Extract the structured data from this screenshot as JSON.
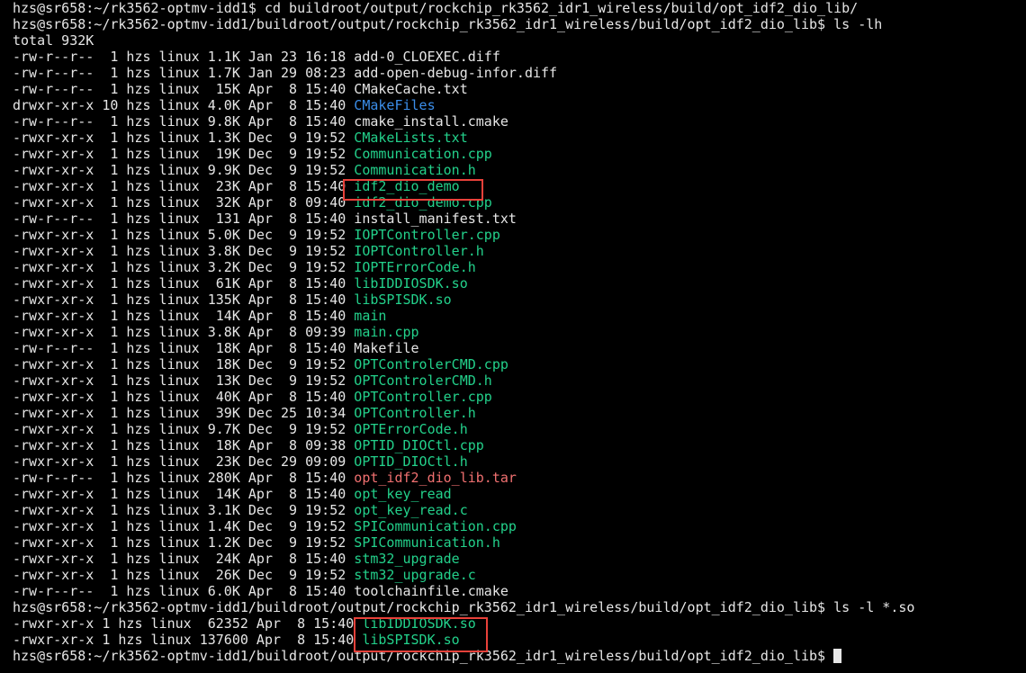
{
  "cut_line": "hzs@sr658:~/rk3562-optmv-idd1$ cd buildroot/output/rockchip_rk3562_idr1_wireless/build/opt_idf2_dio_lib/",
  "prompt1": "hzs@sr658:~/rk3562-optmv-idd1/buildroot/output/rockchip_rk3562_idr1_wireless/build/opt_idf2_dio_lib$ ls -lh",
  "total": "total 932K",
  "listing": [
    {
      "meta": "-rw-r--r--  1 hzs linux 1.1K Jan 23 16:18 ",
      "name": "add-0_CLOEXEC.diff",
      "color": "white"
    },
    {
      "meta": "-rw-r--r--  1 hzs linux 1.7K Jan 29 08:23 ",
      "name": "add-open-debug-infor.diff",
      "color": "white"
    },
    {
      "meta": "-rw-r--r--  1 hzs linux  15K Apr  8 15:40 ",
      "name": "CMakeCache.txt",
      "color": "white"
    },
    {
      "meta": "drwxr-xr-x 10 hzs linux 4.0K Apr  8 15:40 ",
      "name": "CMakeFiles",
      "color": "blue"
    },
    {
      "meta": "-rw-r--r--  1 hzs linux 9.8K Apr  8 15:40 ",
      "name": "cmake_install.cmake",
      "color": "white"
    },
    {
      "meta": "-rwxr-xr-x  1 hzs linux 1.3K Dec  9 19:52 ",
      "name": "CMakeLists.txt",
      "color": "green"
    },
    {
      "meta": "-rwxr-xr-x  1 hzs linux  19K Dec  9 19:52 ",
      "name": "Communication.cpp",
      "color": "green"
    },
    {
      "meta": "-rwxr-xr-x  1 hzs linux 9.9K Dec  9 19:52 ",
      "name": "Communication.h",
      "color": "green"
    },
    {
      "meta": "-rwxr-xr-x  1 hzs linux  23K Apr  8 15:40 ",
      "name": "idf2_dio_demo",
      "color": "green"
    },
    {
      "meta": "-rwxr-xr-x  1 hzs linux  32K Apr  8 09:40 ",
      "name": "idf2_dio_demo.cpp",
      "color": "green"
    },
    {
      "meta": "-rw-r--r--  1 hzs linux  131 Apr  8 15:40 ",
      "name": "install_manifest.txt",
      "color": "white"
    },
    {
      "meta": "-rwxr-xr-x  1 hzs linux 5.0K Dec  9 19:52 ",
      "name": "IOPTController.cpp",
      "color": "green"
    },
    {
      "meta": "-rwxr-xr-x  1 hzs linux 3.8K Dec  9 19:52 ",
      "name": "IOPTController.h",
      "color": "green"
    },
    {
      "meta": "-rwxr-xr-x  1 hzs linux 3.2K Dec  9 19:52 ",
      "name": "IOPTErrorCode.h",
      "color": "green"
    },
    {
      "meta": "-rwxr-xr-x  1 hzs linux  61K Apr  8 15:40 ",
      "name": "libIDDIOSDK.so",
      "color": "green"
    },
    {
      "meta": "-rwxr-xr-x  1 hzs linux 135K Apr  8 15:40 ",
      "name": "libSPISDK.so",
      "color": "green"
    },
    {
      "meta": "-rwxr-xr-x  1 hzs linux  14K Apr  8 15:40 ",
      "name": "main",
      "color": "green"
    },
    {
      "meta": "-rwxr-xr-x  1 hzs linux 3.8K Apr  8 09:39 ",
      "name": "main.cpp",
      "color": "green"
    },
    {
      "meta": "-rw-r--r--  1 hzs linux  18K Apr  8 15:40 ",
      "name": "Makefile",
      "color": "white"
    },
    {
      "meta": "-rwxr-xr-x  1 hzs linux  18K Dec  9 19:52 ",
      "name": "OPTControlerCMD.cpp",
      "color": "green"
    },
    {
      "meta": "-rwxr-xr-x  1 hzs linux  13K Dec  9 19:52 ",
      "name": "OPTControlerCMD.h",
      "color": "green"
    },
    {
      "meta": "-rwxr-xr-x  1 hzs linux  40K Apr  8 15:40 ",
      "name": "OPTController.cpp",
      "color": "green"
    },
    {
      "meta": "-rwxr-xr-x  1 hzs linux  39K Dec 25 10:34 ",
      "name": "OPTController.h",
      "color": "green"
    },
    {
      "meta": "-rwxr-xr-x  1 hzs linux 9.7K Dec  9 19:52 ",
      "name": "OPTErrorCode.h",
      "color": "green"
    },
    {
      "meta": "-rwxr-xr-x  1 hzs linux  18K Apr  8 09:38 ",
      "name": "OPTID_DIOCtl.cpp",
      "color": "green"
    },
    {
      "meta": "-rwxr-xr-x  1 hzs linux  23K Dec 29 09:09 ",
      "name": "OPTID_DIOCtl.h",
      "color": "green"
    },
    {
      "meta": "-rw-r--r--  1 hzs linux 280K Apr  8 15:40 ",
      "name": "opt_idf2_dio_lib.tar",
      "color": "red"
    },
    {
      "meta": "-rwxr-xr-x  1 hzs linux  14K Apr  8 15:40 ",
      "name": "opt_key_read",
      "color": "green"
    },
    {
      "meta": "-rwxr-xr-x  1 hzs linux 3.1K Dec  9 19:52 ",
      "name": "opt_key_read.c",
      "color": "green"
    },
    {
      "meta": "-rwxr-xr-x  1 hzs linux 1.4K Dec  9 19:52 ",
      "name": "SPICommunication.cpp",
      "color": "green"
    },
    {
      "meta": "-rwxr-xr-x  1 hzs linux 1.2K Dec  9 19:52 ",
      "name": "SPICommunication.h",
      "color": "green"
    },
    {
      "meta": "-rwxr-xr-x  1 hzs linux  24K Apr  8 15:40 ",
      "name": "stm32_upgrade",
      "color": "green"
    },
    {
      "meta": "-rwxr-xr-x  1 hzs linux  26K Dec  9 19:52 ",
      "name": "stm32_upgrade.c",
      "color": "green"
    },
    {
      "meta": "-rw-r--r--  1 hzs linux 6.0K Apr  8 15:40 ",
      "name": "toolchainfile.cmake",
      "color": "white"
    }
  ],
  "prompt2": "hzs@sr658:~/rk3562-optmv-idd1/buildroot/output/rockchip_rk3562_idr1_wireless/build/opt_idf2_dio_lib$ ls -l *.so",
  "so_listing": [
    {
      "meta": "-rwxr-xr-x 1 hzs linux  62352 Apr  8 15:40 ",
      "name": "libIDDIOSDK.so",
      "color": "green"
    },
    {
      "meta": "-rwxr-xr-x 1 hzs linux 137600 Apr  8 15:40 ",
      "name": "libSPISDK.so",
      "color": "green"
    }
  ],
  "prompt3": "hzs@sr658:~/rk3562-optmv-idd1/buildroot/output/rockchip_rk3562_idr1_wireless/build/opt_idf2_dio_lib$ ",
  "colors": {
    "background": "#000000",
    "text": "#e6e6e6",
    "executable": "#23d18b",
    "directory": "#3b8eea",
    "archive": "#f07070",
    "highlight_box": "#e8413a"
  }
}
